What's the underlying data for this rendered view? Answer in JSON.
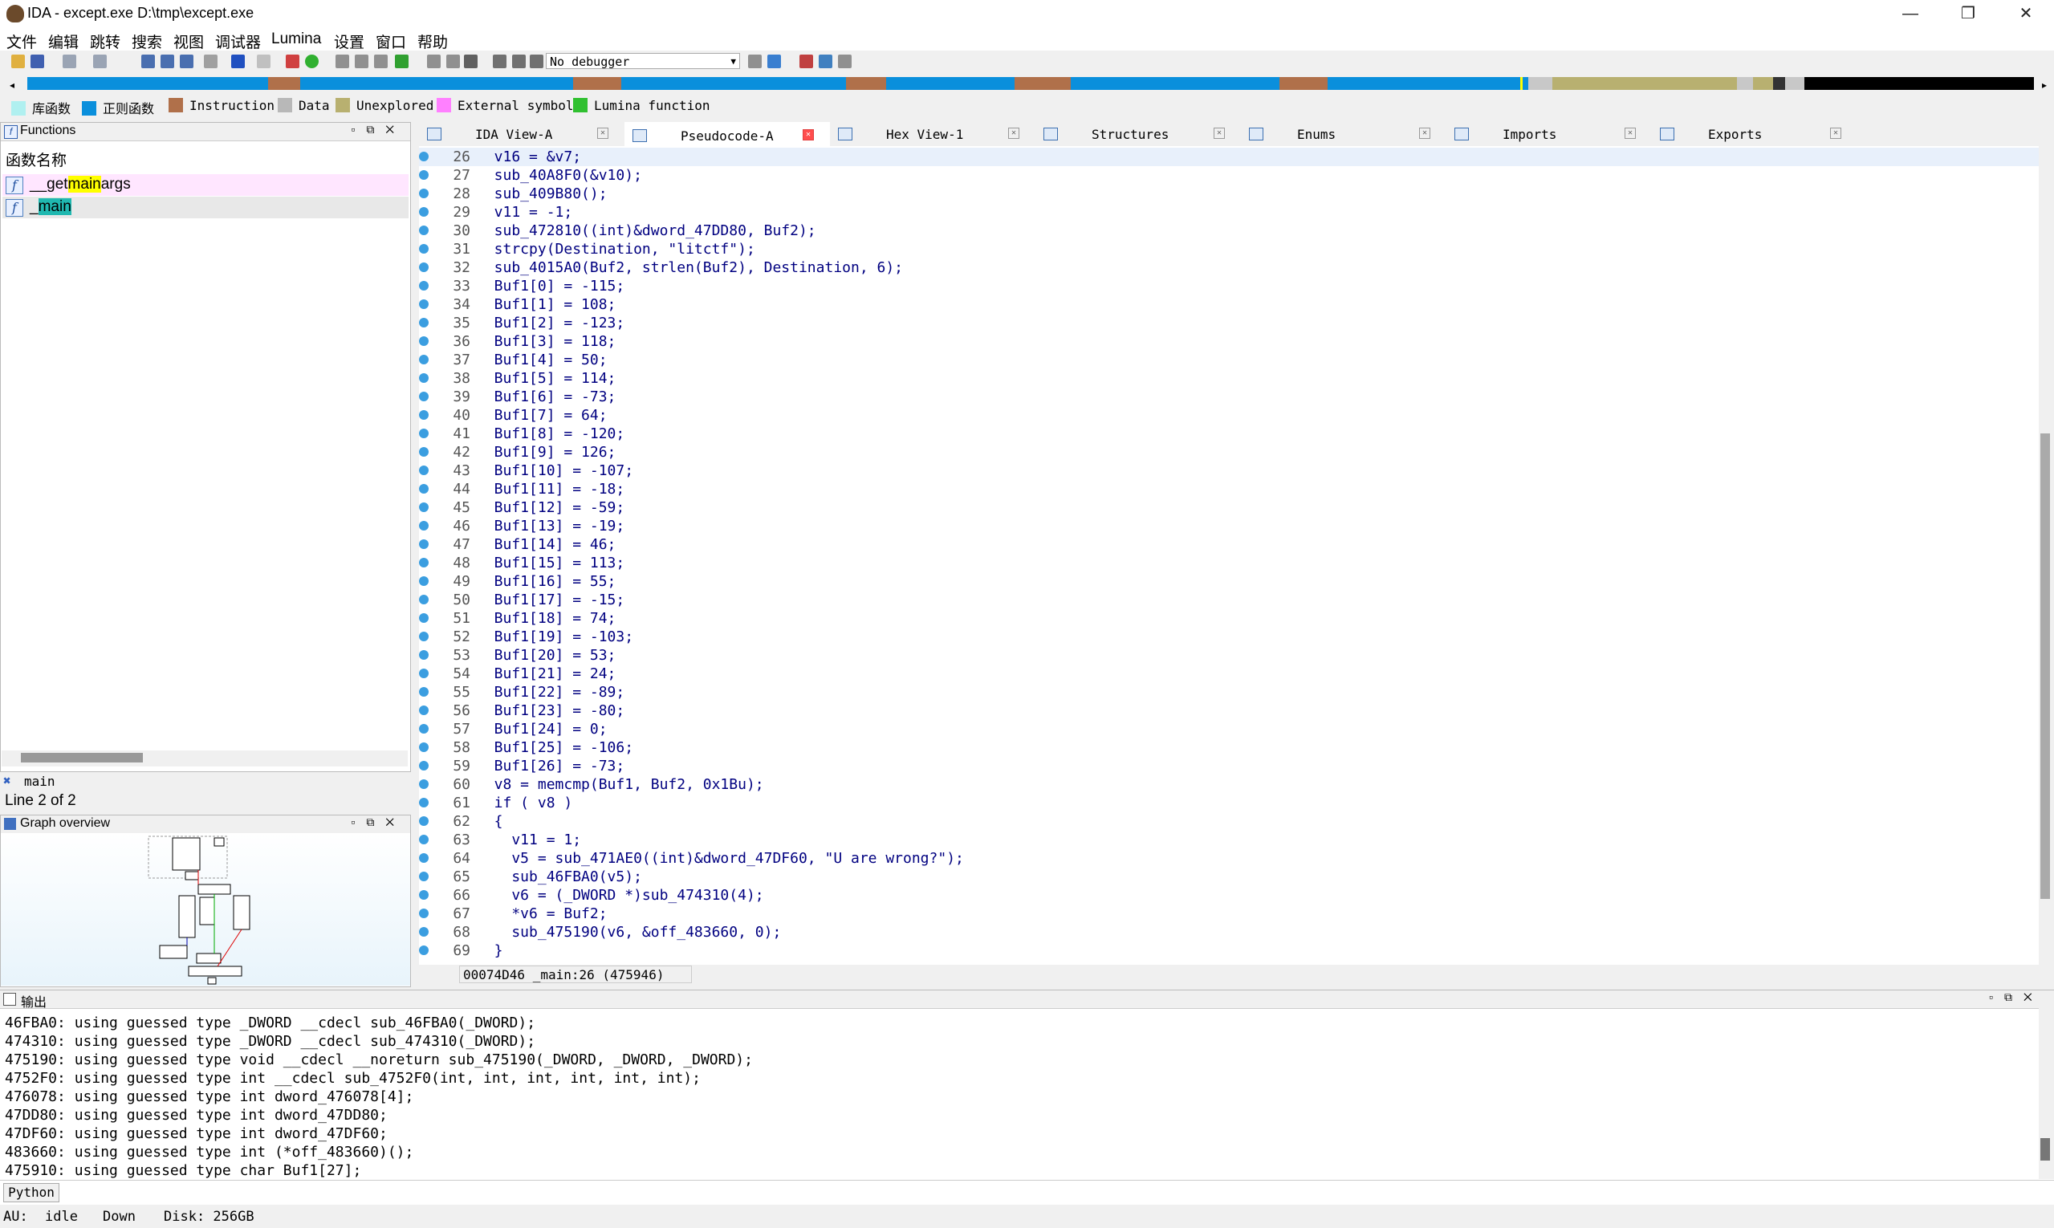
{
  "window": {
    "title": "IDA - except.exe D:\\tmp\\except.exe",
    "minimize": "—",
    "maximize": "❐",
    "close": "✕"
  },
  "menu": [
    "文件",
    "编辑",
    "跳转",
    "搜索",
    "视图",
    "调试器",
    "Lumina",
    "设置",
    "窗口",
    "帮助"
  ],
  "toolbar": {
    "debugger": "No debugger"
  },
  "legend": [
    {
      "label": "库函数",
      "color": "#b0f0f0"
    },
    {
      "label": "正则函数",
      "color": "#0a8fdc"
    },
    {
      "label": "Instruction",
      "color": "#b0704a"
    },
    {
      "label": "Data",
      "color": "#b8b8b8"
    },
    {
      "label": "Unexplored",
      "color": "#b8b070"
    },
    {
      "label": "External symbol",
      "color": "#ff80ff"
    },
    {
      "label": "Lumina function",
      "color": "#30c030"
    }
  ],
  "functions": {
    "title": "Functions",
    "column": "函数名称",
    "items": [
      {
        "prefix": "__get",
        "highlight": "main",
        "suffix": "args"
      },
      {
        "prefix": "_",
        "highlight": "main",
        "suffix": ""
      }
    ],
    "filter": "main",
    "line_info": "Line 2 of 2"
  },
  "graph": {
    "title": "Graph overview"
  },
  "tabs": [
    {
      "label": "IDA View-A"
    },
    {
      "label": "Pseudocode-A"
    },
    {
      "label": "Hex View-1"
    },
    {
      "label": "Structures"
    },
    {
      "label": "Enums"
    },
    {
      "label": "Imports"
    },
    {
      "label": "Exports"
    }
  ],
  "code": [
    {
      "ln": "26",
      "t": "  v16 = &v7;"
    },
    {
      "ln": "27",
      "t": "  sub_40A8F0(&v10);"
    },
    {
      "ln": "28",
      "t": "  sub_409B80();"
    },
    {
      "ln": "29",
      "t": "  v11 = -1;"
    },
    {
      "ln": "30",
      "t": "  sub_472810((int)&dword_47DD80, Buf2);"
    },
    {
      "ln": "31",
      "t": "  strcpy(Destination, \"litctf\");"
    },
    {
      "ln": "32",
      "t": "  sub_4015A0(Buf2, strlen(Buf2), Destination, 6);"
    },
    {
      "ln": "33",
      "t": "  Buf1[0] = -115;"
    },
    {
      "ln": "34",
      "t": "  Buf1[1] = 108;"
    },
    {
      "ln": "35",
      "t": "  Buf1[2] = -123;"
    },
    {
      "ln": "36",
      "t": "  Buf1[3] = 118;"
    },
    {
      "ln": "37",
      "t": "  Buf1[4] = 50;"
    },
    {
      "ln": "38",
      "t": "  Buf1[5] = 114;"
    },
    {
      "ln": "39",
      "t": "  Buf1[6] = -73;"
    },
    {
      "ln": "40",
      "t": "  Buf1[7] = 64;"
    },
    {
      "ln": "41",
      "t": "  Buf1[8] = -120;"
    },
    {
      "ln": "42",
      "t": "  Buf1[9] = 126;"
    },
    {
      "ln": "43",
      "t": "  Buf1[10] = -107;"
    },
    {
      "ln": "44",
      "t": "  Buf1[11] = -18;"
    },
    {
      "ln": "45",
      "t": "  Buf1[12] = -59;"
    },
    {
      "ln": "46",
      "t": "  Buf1[13] = -19;"
    },
    {
      "ln": "47",
      "t": "  Buf1[14] = 46;"
    },
    {
      "ln": "48",
      "t": "  Buf1[15] = 113;"
    },
    {
      "ln": "49",
      "t": "  Buf1[16] = 55;"
    },
    {
      "ln": "50",
      "t": "  Buf1[17] = -15;"
    },
    {
      "ln": "51",
      "t": "  Buf1[18] = 74;"
    },
    {
      "ln": "52",
      "t": "  Buf1[19] = -103;"
    },
    {
      "ln": "53",
      "t": "  Buf1[20] = 53;"
    },
    {
      "ln": "54",
      "t": "  Buf1[21] = 24;"
    },
    {
      "ln": "55",
      "t": "  Buf1[22] = -89;"
    },
    {
      "ln": "56",
      "t": "  Buf1[23] = -80;"
    },
    {
      "ln": "57",
      "t": "  Buf1[24] = 0;"
    },
    {
      "ln": "58",
      "t": "  Buf1[25] = -106;"
    },
    {
      "ln": "59",
      "t": "  Buf1[26] = -73;"
    },
    {
      "ln": "60",
      "t": "  v8 = memcmp(Buf1, Buf2, 0x1Bu);"
    },
    {
      "ln": "61",
      "t": "  if ( v8 )"
    },
    {
      "ln": "62",
      "t": "  {"
    },
    {
      "ln": "63",
      "t": "    v11 = 1;"
    },
    {
      "ln": "64",
      "t": "    v5 = sub_471AE0((int)&dword_47DF60, \"U are wrong?\");"
    },
    {
      "ln": "65",
      "t": "    sub_46FBA0(v5);"
    },
    {
      "ln": "66",
      "t": "    v6 = (_DWORD *)sub_474310(4);"
    },
    {
      "ln": "67",
      "t": "    *v6 = Buf2;"
    },
    {
      "ln": "68",
      "t": "    sub_475190(v6, &off_483660, 0);"
    },
    {
      "ln": "69",
      "t": "  }"
    }
  ],
  "code_status": "00074D46 _main:26 (475946)",
  "output": {
    "title": "输出",
    "lines": [
      "46FBA0: using guessed type _DWORD __cdecl sub_46FBA0(_DWORD);",
      "474310: using guessed type _DWORD __cdecl sub_474310(_DWORD);",
      "475190: using guessed type void __cdecl __noreturn sub_475190(_DWORD, _DWORD, _DWORD);",
      "4752F0: using guessed type int __cdecl sub_4752F0(int, int, int, int, int, int);",
      "476078: using guessed type int dword_476078[4];",
      "47DD80: using guessed type int dword_47DD80;",
      "47DF60: using guessed type int dword_47DF60;",
      "483660: using guessed type int (*off_483660)();",
      "475910: using guessed type char Buf1[27];"
    ]
  },
  "python_label": "Python",
  "status": {
    "au": "AU:",
    "state": "idle",
    "dir": "Down",
    "disk": "Disk: 256GB"
  }
}
